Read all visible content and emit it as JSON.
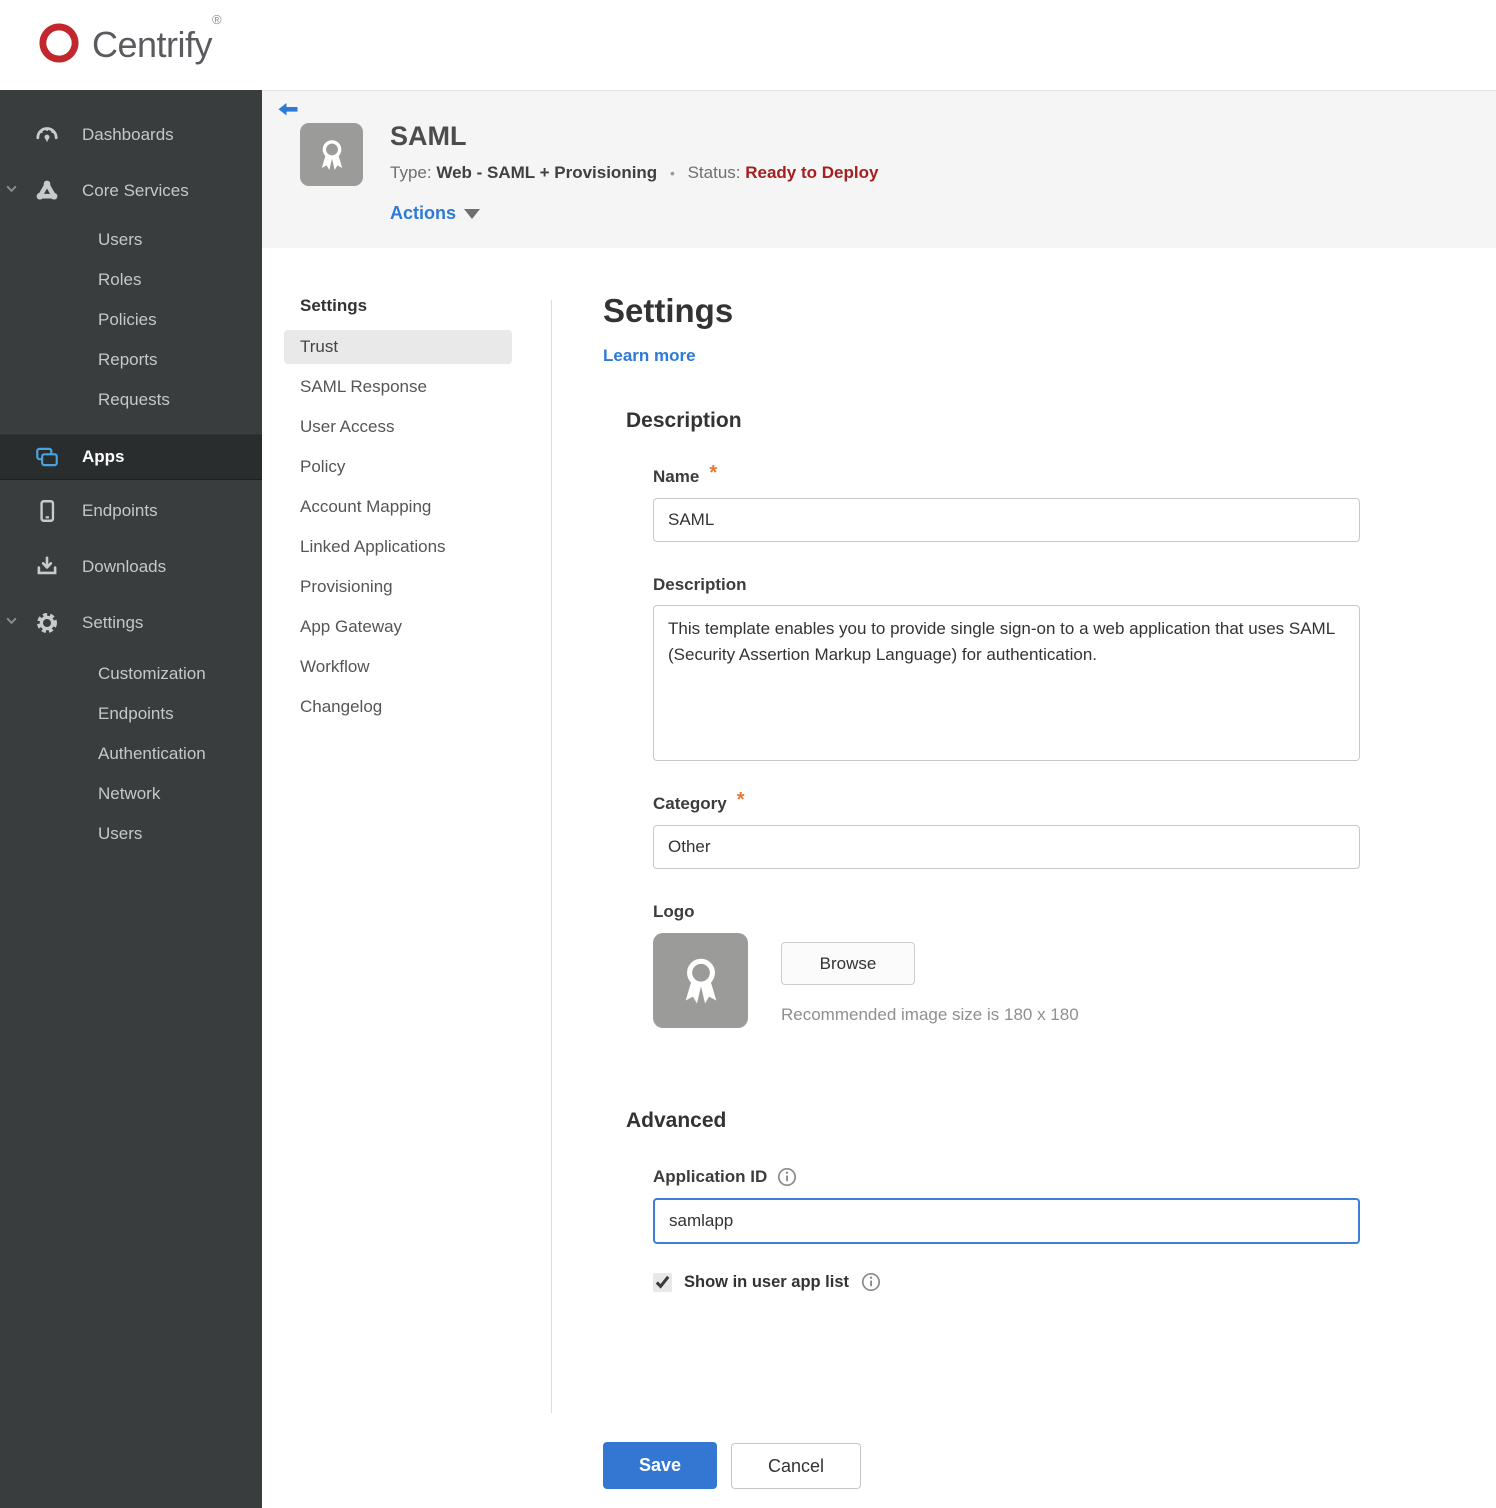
{
  "brand": {
    "name": "Centrify",
    "registered_mark": "®"
  },
  "sidebar": {
    "items": [
      {
        "label": "Dashboards"
      },
      {
        "label": "Core Services"
      },
      {
        "label": "Users"
      },
      {
        "label": "Roles"
      },
      {
        "label": "Policies"
      },
      {
        "label": "Reports"
      },
      {
        "label": "Requests"
      },
      {
        "label": "Apps"
      },
      {
        "label": "Endpoints"
      },
      {
        "label": "Downloads"
      },
      {
        "label": "Settings"
      },
      {
        "label": "Customization"
      },
      {
        "label": "Endpoints"
      },
      {
        "label": "Authentication"
      },
      {
        "label": "Network"
      },
      {
        "label": "Users"
      }
    ]
  },
  "header": {
    "app_title": "SAML",
    "type_label": "Type:",
    "type_value": "Web - SAML + Provisioning",
    "dot_separator": "•",
    "status_label": "Status:",
    "status_value": "Ready to Deploy",
    "actions_label": "Actions"
  },
  "subnav": {
    "heading": "Settings",
    "items": [
      {
        "label": "Trust",
        "active": true
      },
      {
        "label": "SAML Response"
      },
      {
        "label": "User Access"
      },
      {
        "label": "Policy"
      },
      {
        "label": "Account Mapping"
      },
      {
        "label": "Linked Applications"
      },
      {
        "label": "Provisioning"
      },
      {
        "label": "App Gateway"
      },
      {
        "label": "Workflow"
      },
      {
        "label": "Changelog"
      }
    ]
  },
  "main": {
    "title": "Settings",
    "learn_more_label": "Learn more",
    "description_section": {
      "heading": "Description",
      "name": {
        "label": "Name",
        "required_mark": "*",
        "value": "SAML"
      },
      "description": {
        "label": "Description",
        "value": "This template enables you to provide single sign-on to a web application that uses SAML (Security Assertion Markup Language) for authentication."
      },
      "category": {
        "label": "Category",
        "required_mark": "*",
        "value": "Other"
      },
      "logo": {
        "label": "Logo",
        "browse_label": "Browse",
        "hint": "Recommended image size is 180 x 180"
      }
    },
    "advanced_section": {
      "heading": "Advanced",
      "application_id": {
        "label": "Application ID",
        "value": "samlapp"
      },
      "show_in_user_app_list": {
        "label": "Show in user app list",
        "checked": true
      }
    },
    "footer": {
      "save_label": "Save",
      "cancel_label": "Cancel"
    }
  },
  "icons": {
    "back": "arrow-left",
    "app_logo": "award-ribbon",
    "dashboards": "gauge",
    "core_services": "cluster",
    "apps": "stacked-windows",
    "endpoints": "mobile-device",
    "downloads": "download-tray",
    "settings": "gear",
    "info": "circled-i"
  },
  "colors": {
    "accent_blue": "#3377d3",
    "link_blue": "#2e7ad6",
    "apps_icon_blue": "#4aa3df",
    "status_red": "#a32020",
    "required_orange": "#e8762c",
    "brand_red": "#c1272d",
    "sidebar_bg": "#3a3d3d",
    "sidebar_active_bg": "#2a2d2d",
    "header_band_bg": "#f5f5f5",
    "focus_border": "#3b7fd9"
  }
}
